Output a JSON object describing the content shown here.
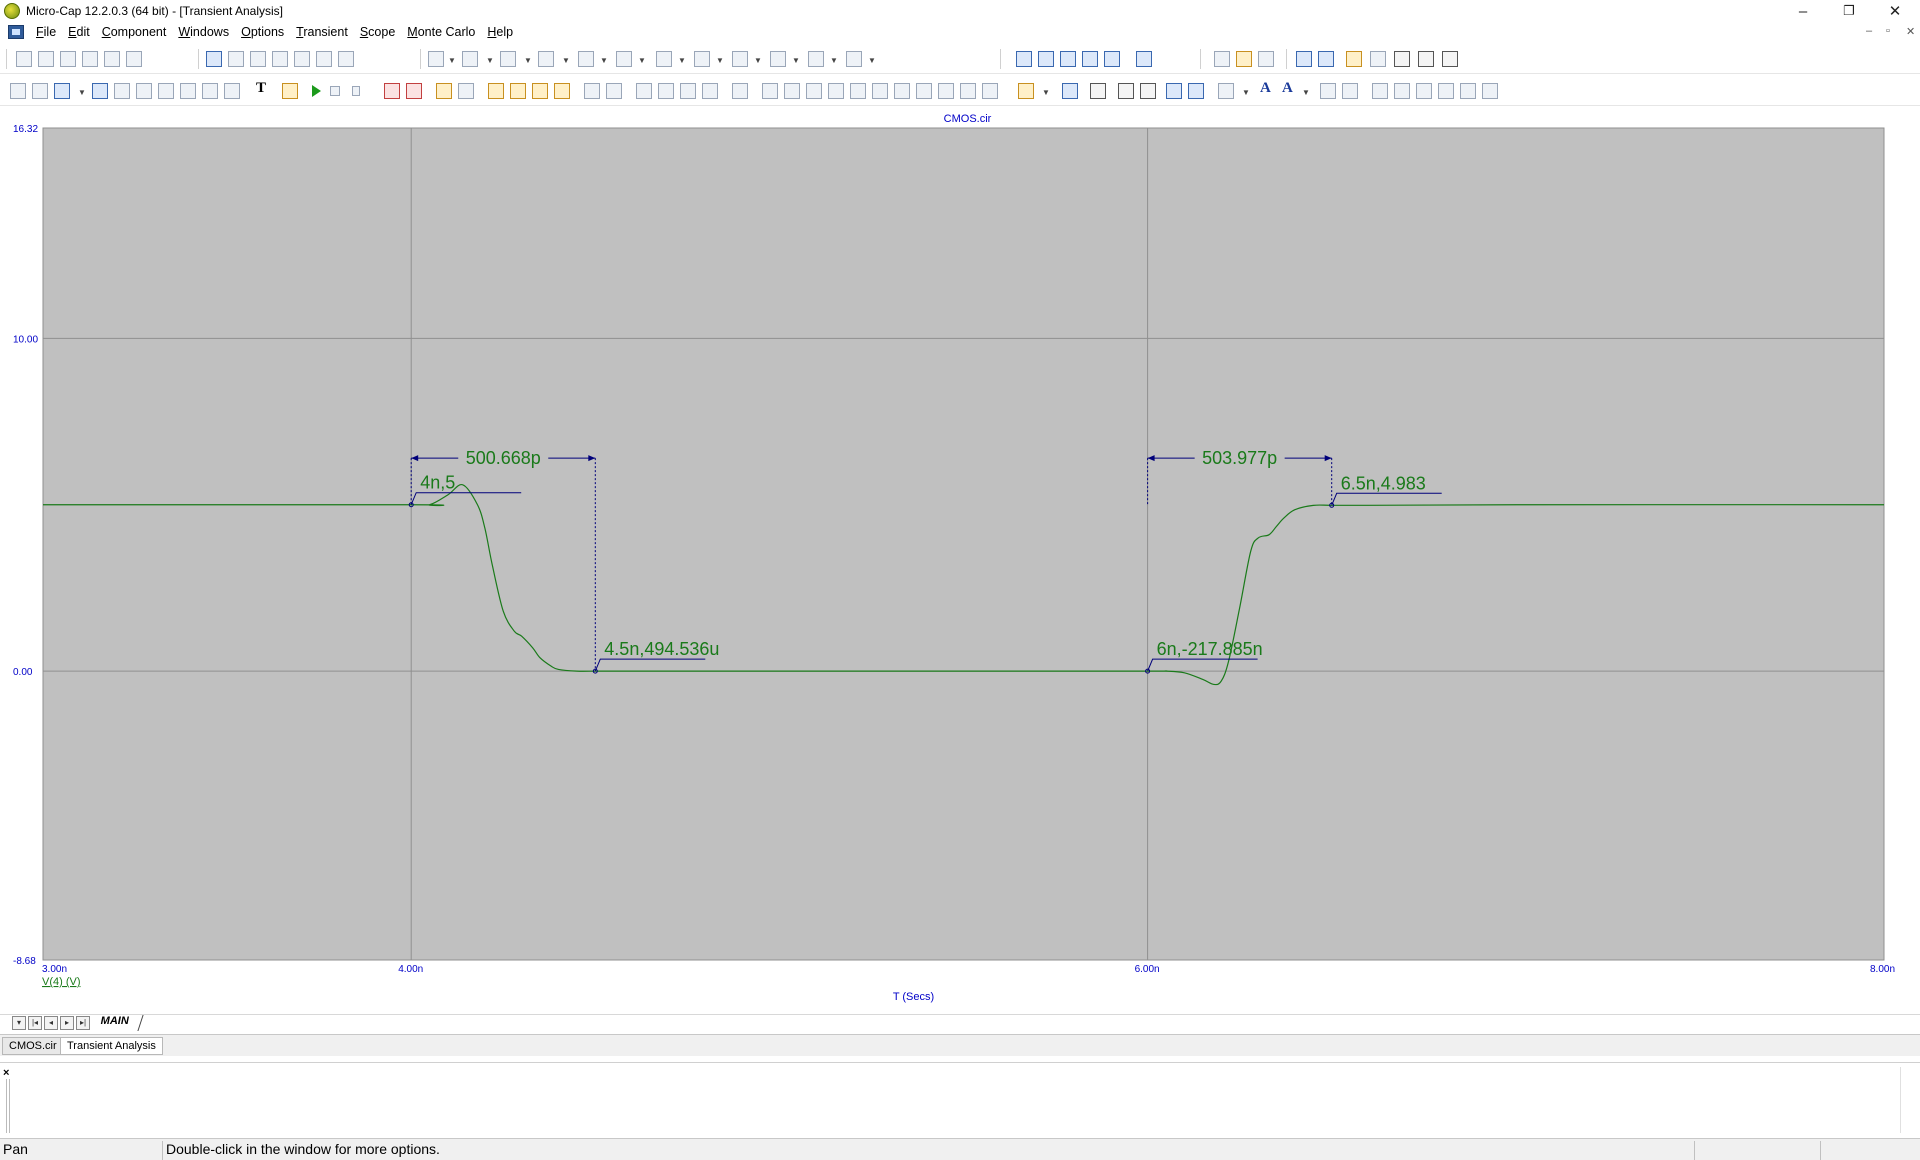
{
  "window": {
    "title": "Micro-Cap 12.2.0.3 (64 bit) - [Transient Analysis]",
    "controls": [
      "–",
      "❐",
      "✕"
    ]
  },
  "menu": {
    "items": [
      {
        "pre": "",
        "u": "F",
        "post": "ile"
      },
      {
        "pre": "",
        "u": "E",
        "post": "dit"
      },
      {
        "pre": "",
        "u": "C",
        "post": "omponent"
      },
      {
        "pre": "",
        "u": "W",
        "post": "indows"
      },
      {
        "pre": "",
        "u": "O",
        "post": "ptions"
      },
      {
        "pre": "",
        "u": "T",
        "post": "ransient"
      },
      {
        "pre": "",
        "u": "S",
        "post": "cope"
      },
      {
        "pre": "",
        "u": "M",
        "post": "onte Carlo"
      },
      {
        "pre": "",
        "u": "H",
        "post": "elp"
      }
    ],
    "mdi_controls": [
      "–",
      "▫",
      "✕"
    ]
  },
  "toolbar": {
    "text_tool_glyph": "T",
    "font_tool_glyph": "A",
    "style_tool_glyph": "A"
  },
  "plot": {
    "title": "CMOS.cir",
    "xlabel": "T (Secs)",
    "trace_label": "V(4) (V)",
    "y_ticks": [
      {
        "value": 16.32,
        "label": "16.32"
      },
      {
        "value": 10.0,
        "label": "10.00"
      },
      {
        "value": 0.0,
        "label": "0.00"
      },
      {
        "value": -8.68,
        "label": "-8.68"
      }
    ],
    "x_ticks": [
      {
        "value": 3.0,
        "label": "3.00n"
      },
      {
        "value": 4.0,
        "label": "4.00n"
      },
      {
        "value": 6.0,
        "label": "6.00n"
      },
      {
        "value": 8.0,
        "label": "8.00n"
      }
    ],
    "colors": {
      "background": "#c0c0c0",
      "grid": "#8f8f8f",
      "trace": "#1a7a1a",
      "axis_text": "#0000c8",
      "dimension": "#00007a",
      "label_text": "#1a7a1a"
    }
  },
  "chart_data": {
    "type": "line",
    "title": "CMOS.cir",
    "xlabel": "T (Secs)",
    "ylabel": "",
    "xlim": [
      3.0,
      8.0
    ],
    "ylim": [
      -8.68,
      16.32
    ],
    "x_unit": "ns",
    "series": [
      {
        "name": "V(4) (V)",
        "x": [
          3.0,
          4.0,
          4.05,
          4.1,
          4.14,
          4.18,
          4.2,
          4.22,
          4.25,
          4.28,
          4.3,
          4.33,
          4.35,
          4.38,
          4.4,
          4.45,
          4.5,
          4.55,
          5.0,
          5.5,
          6.0,
          6.05,
          6.1,
          6.15,
          6.18,
          6.2,
          6.22,
          6.25,
          6.28,
          6.3,
          6.33,
          6.35,
          6.37,
          6.4,
          6.45,
          6.5,
          6.6,
          7.0,
          8.0
        ],
        "y": [
          5.0,
          5.0,
          5.0,
          5.3,
          5.6,
          5.0,
          4.3,
          3.2,
          1.8,
          1.2,
          1.05,
          0.7,
          0.4,
          0.15,
          0.05,
          0.0,
          0.0,
          0.0,
          0.0,
          0.0,
          0.0,
          0.0,
          -0.05,
          -0.25,
          -0.4,
          -0.3,
          0.3,
          1.9,
          3.6,
          4.0,
          4.1,
          4.35,
          4.6,
          4.85,
          4.98,
          4.983,
          4.983,
          5.0,
          5.0
        ]
      }
    ],
    "annotations": [
      {
        "type": "point",
        "x": 4.0,
        "y": 5.0,
        "label": "4n,5"
      },
      {
        "type": "point",
        "x": 4.5,
        "y": 0.000494536,
        "label": "4.5n,494.536u"
      },
      {
        "type": "point",
        "x": 6.0,
        "y": -2.17885e-07,
        "label": "6n,-217.885n"
      },
      {
        "type": "point",
        "x": 6.5,
        "y": 4.983,
        "label": "6.5n,4.983"
      },
      {
        "type": "horizontal-dimension",
        "x1": 4.0,
        "x2": 4.5,
        "y": 6.4,
        "label": "500.668p"
      },
      {
        "type": "horizontal-dimension",
        "x1": 6.0,
        "x2": 6.5,
        "y": 6.4,
        "label": "503.977p"
      }
    ]
  },
  "tabs": {
    "page_tab": "MAIN",
    "documents": [
      "CMOS.cir",
      "Transient Analysis"
    ]
  },
  "output_pane": {
    "close_glyph": "×"
  },
  "status": {
    "mode": "Pan",
    "message": "Double-click in the window for more options."
  }
}
